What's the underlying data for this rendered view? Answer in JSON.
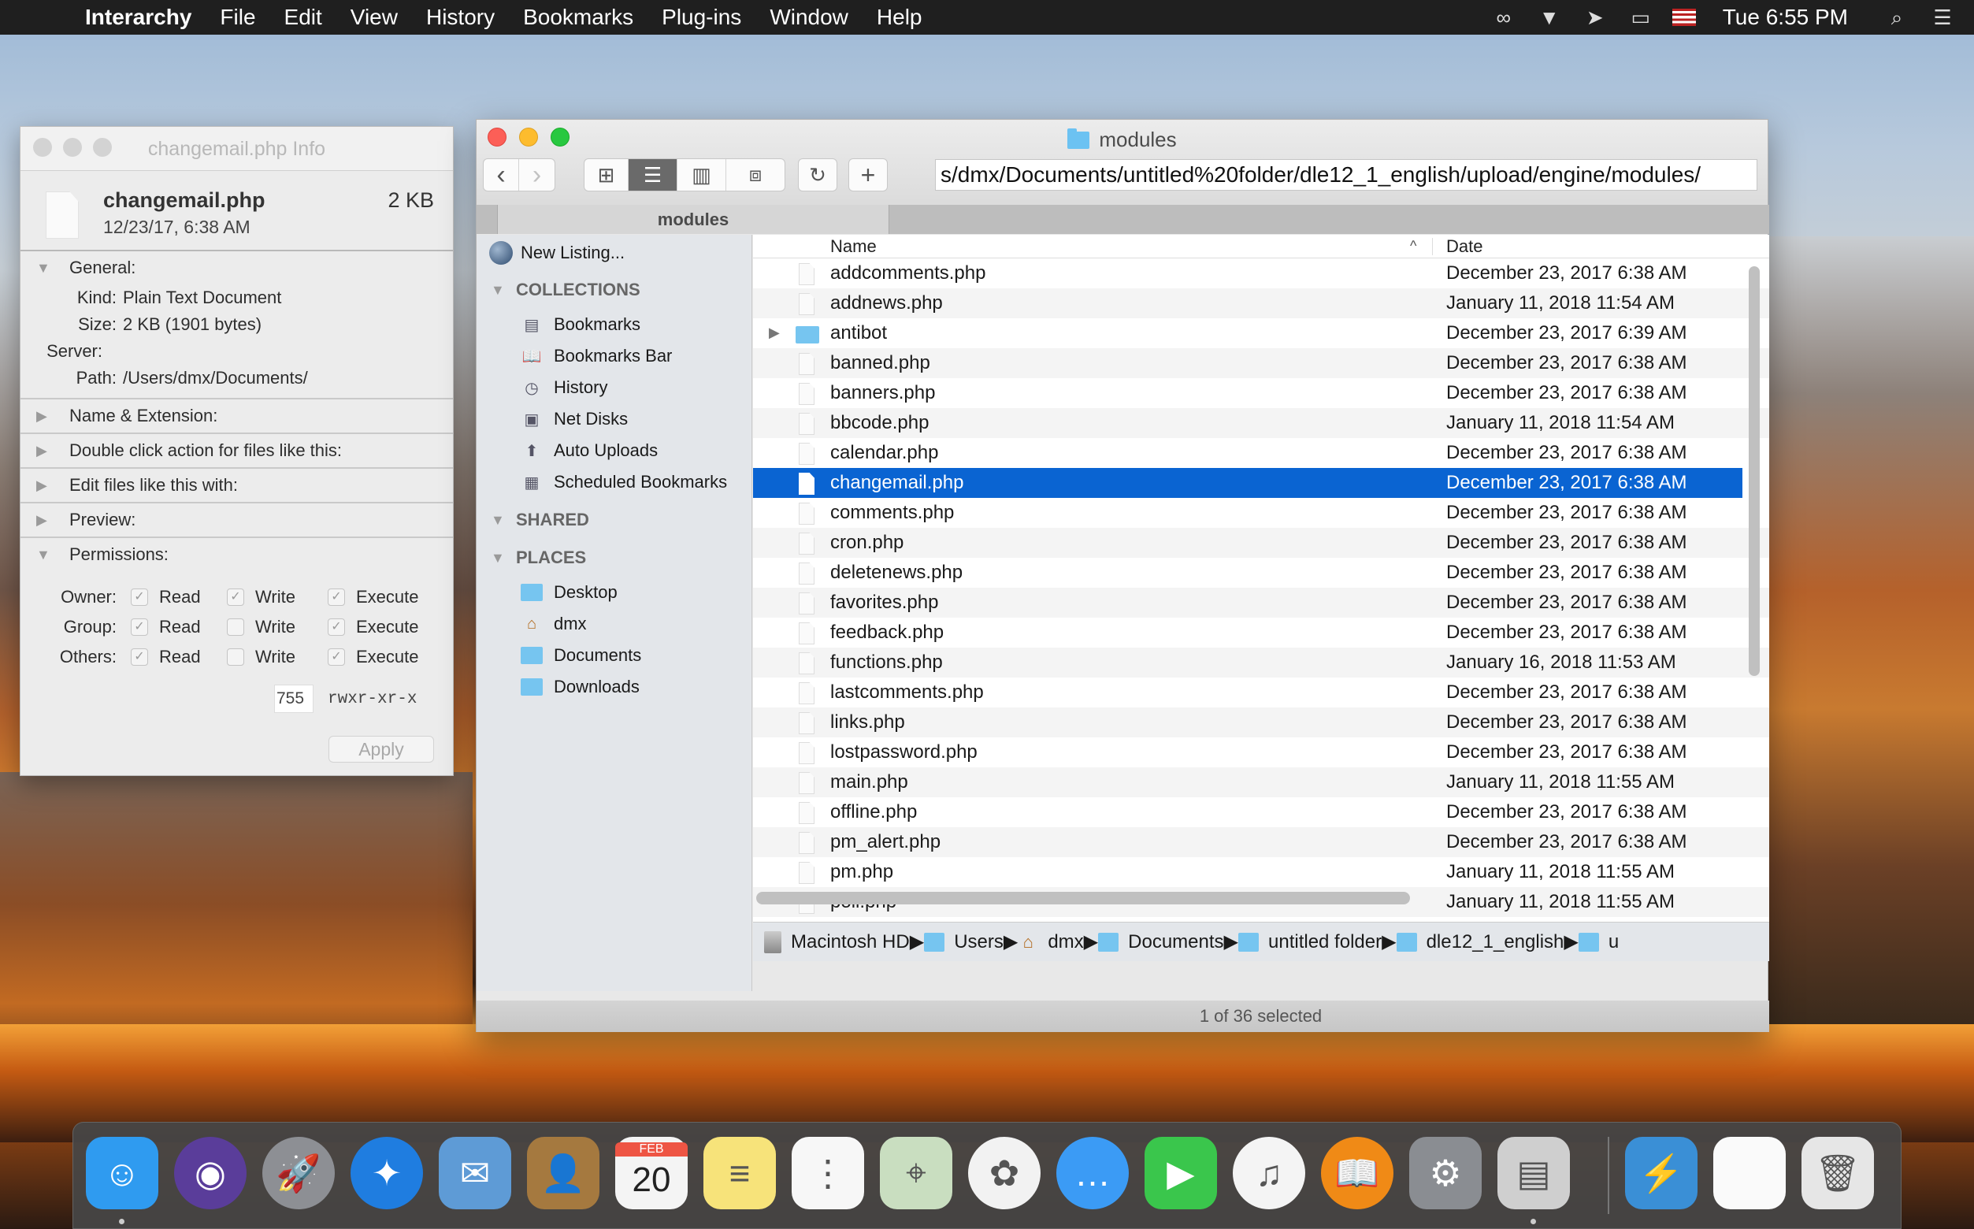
{
  "menubar": {
    "apple_icon": "apple-logo",
    "app_name": "Interarchy",
    "items": [
      "File",
      "Edit",
      "View",
      "History",
      "Bookmarks",
      "Plug-ins",
      "Window",
      "Help"
    ],
    "status_icons": [
      "creative-cloud-icon",
      "airdrop-display-icon",
      "grab-icon",
      "screen-mirroring-icon",
      "us-flag-input-icon"
    ],
    "clock": "Tue 6:55 PM",
    "search_icon": "spotlight-icon",
    "notifications_icon": "notification-center-icon"
  },
  "info_window": {
    "title": "changemail.php Info",
    "file_name": "changemail.php",
    "file_date": "12/23/17, 6:38 AM",
    "file_size": "2 KB",
    "general": {
      "label": "General:",
      "kind_label": "Kind:",
      "kind": "Plain Text Document",
      "size_label": "Size:",
      "size": "2 KB (1901 bytes)",
      "server_label": "Server:",
      "server": "",
      "path_label": "Path:",
      "path": "/Users/dmx/Documents/"
    },
    "collapsed_sections": [
      "Name & Extension:",
      "Double click action for files like this:",
      "Edit files like this with:",
      "Preview:"
    ],
    "permissions": {
      "label": "Permissions:",
      "read_label": "Read",
      "write_label": "Write",
      "execute_label": "Execute",
      "rows": [
        {
          "who": "Owner:",
          "read": true,
          "write": true,
          "execute": true
        },
        {
          "who": "Group:",
          "read": true,
          "write": false,
          "execute": true
        },
        {
          "who": "Others:",
          "read": true,
          "write": false,
          "execute": true
        }
      ],
      "octal": "755",
      "symbolic": "rwxr-xr-x",
      "apply_label": "Apply"
    }
  },
  "browser_window": {
    "title": "modules",
    "toolbar": {
      "back": "‹",
      "forward": "›",
      "view_icons": "⊞",
      "view_list": "☰",
      "view_columns": "▥",
      "view_coverflow": "⧈",
      "refresh": "↻",
      "add": "+"
    },
    "url": "s/dmx/Documents/untitled%20folder/dle12_1_english/upload/engine/modules/",
    "tab_label": "modules",
    "sidebar": {
      "new_listing": "New Listing...",
      "sections": [
        {
          "title": "COLLECTIONS",
          "items": [
            {
              "label": "Bookmarks",
              "icon": "bookmarks-icon"
            },
            {
              "label": "Bookmarks Bar",
              "icon": "bookmarks-bar-icon"
            },
            {
              "label": "History",
              "icon": "history-clock-icon"
            },
            {
              "label": "Net Disks",
              "icon": "net-disks-icon"
            },
            {
              "label": "Auto Uploads",
              "icon": "auto-uploads-icon"
            },
            {
              "label": "Scheduled Bookmarks",
              "icon": "calendar-icon"
            }
          ]
        },
        {
          "title": "SHARED",
          "items": []
        },
        {
          "title": "PLACES",
          "items": [
            {
              "label": "Desktop",
              "icon": "desktop-folder-icon"
            },
            {
              "label": "dmx",
              "icon": "home-icon"
            },
            {
              "label": "Documents",
              "icon": "documents-folder-icon"
            },
            {
              "label": "Downloads",
              "icon": "downloads-folder-icon"
            }
          ]
        }
      ]
    },
    "columns": {
      "name": "Name",
      "date": "Date",
      "sort_indicator": "^"
    },
    "files": [
      {
        "name": "addcomments.php",
        "date": "December 23, 2017 6:38 AM",
        "type": "file"
      },
      {
        "name": "addnews.php",
        "date": "January 11, 2018 11:54 AM",
        "type": "file"
      },
      {
        "name": "antibot",
        "date": "December 23, 2017 6:39 AM",
        "type": "folder"
      },
      {
        "name": "banned.php",
        "date": "December 23, 2017 6:38 AM",
        "type": "file"
      },
      {
        "name": "banners.php",
        "date": "December 23, 2017 6:38 AM",
        "type": "file"
      },
      {
        "name": "bbcode.php",
        "date": "January 11, 2018 11:54 AM",
        "type": "file"
      },
      {
        "name": "calendar.php",
        "date": "December 23, 2017 6:38 AM",
        "type": "file"
      },
      {
        "name": "changemail.php",
        "date": "December 23, 2017 6:38 AM",
        "type": "file",
        "selected": true
      },
      {
        "name": "comments.php",
        "date": "December 23, 2017 6:38 AM",
        "type": "file"
      },
      {
        "name": "cron.php",
        "date": "December 23, 2017 6:38 AM",
        "type": "file"
      },
      {
        "name": "deletenews.php",
        "date": "December 23, 2017 6:38 AM",
        "type": "file"
      },
      {
        "name": "favorites.php",
        "date": "December 23, 2017 6:38 AM",
        "type": "file"
      },
      {
        "name": "feedback.php",
        "date": "December 23, 2017 6:38 AM",
        "type": "file"
      },
      {
        "name": "functions.php",
        "date": "January 16, 2018 11:53 AM",
        "type": "file"
      },
      {
        "name": "lastcomments.php",
        "date": "December 23, 2017 6:38 AM",
        "type": "file"
      },
      {
        "name": "links.php",
        "date": "December 23, 2017 6:38 AM",
        "type": "file"
      },
      {
        "name": "lostpassword.php",
        "date": "December 23, 2017 6:38 AM",
        "type": "file"
      },
      {
        "name": "main.php",
        "date": "January 11, 2018 11:55 AM",
        "type": "file"
      },
      {
        "name": "offline.php",
        "date": "December 23, 2017 6:38 AM",
        "type": "file"
      },
      {
        "name": "pm_alert.php",
        "date": "December 23, 2017 6:38 AM",
        "type": "file"
      },
      {
        "name": "pm.php",
        "date": "January 11, 2018 11:55 AM",
        "type": "file"
      },
      {
        "name": "poll.php",
        "date": "January 11, 2018 11:55 AM",
        "type": "file"
      }
    ],
    "path_bar": [
      "Macintosh HD",
      "Users",
      "dmx",
      "Documents",
      "untitled folder",
      "dle12_1_english",
      "u"
    ],
    "status": "1 of 36 selected"
  },
  "dock": {
    "apps": [
      {
        "name": "Finder",
        "icon": "finder-icon",
        "color": "#2f9bf0",
        "running": true
      },
      {
        "name": "Siri",
        "icon": "siri-icon",
        "color": "#5a3d9a"
      },
      {
        "name": "Launchpad",
        "icon": "launchpad-icon",
        "color": "#8d8f94"
      },
      {
        "name": "Safari",
        "icon": "safari-icon",
        "color": "#1f7de0"
      },
      {
        "name": "Mail",
        "icon": "mail-icon",
        "color": "#5e9bd6"
      },
      {
        "name": "Contacts",
        "icon": "contacts-icon",
        "color": "#a5793f"
      },
      {
        "name": "Calendar",
        "icon": "calendar-app-icon",
        "color": "#f4f4f4",
        "month": "FEB",
        "day": "20"
      },
      {
        "name": "Notes",
        "icon": "notes-icon",
        "color": "#f7e37a"
      },
      {
        "name": "Reminders",
        "icon": "reminders-icon",
        "color": "#f7f7f7"
      },
      {
        "name": "Maps",
        "icon": "maps-icon",
        "color": "#c9dec0"
      },
      {
        "name": "Photos",
        "icon": "photos-icon",
        "color": "#f2f2f2"
      },
      {
        "name": "Messages",
        "icon": "messages-icon",
        "color": "#3b9bf5"
      },
      {
        "name": "FaceTime",
        "icon": "facetime-icon",
        "color": "#3ac64c"
      },
      {
        "name": "iTunes",
        "icon": "itunes-icon",
        "color": "#f4f4f4"
      },
      {
        "name": "iBooks",
        "icon": "ibooks-icon",
        "color": "#f08a16"
      },
      {
        "name": "System Preferences",
        "icon": "system-preferences-icon",
        "color": "#8a8d92"
      },
      {
        "name": "Interarchy",
        "icon": "interarchy-icon",
        "color": "#cfcfcf",
        "running": true
      }
    ],
    "others": [
      {
        "name": "Downloads stack",
        "icon": "downloads-stack-icon",
        "color": "#3a8fd6"
      },
      {
        "name": "Document",
        "icon": "document-icon",
        "color": "#fafafa"
      },
      {
        "name": "Trash",
        "icon": "trash-icon",
        "color": "#e6e6e6"
      }
    ]
  }
}
